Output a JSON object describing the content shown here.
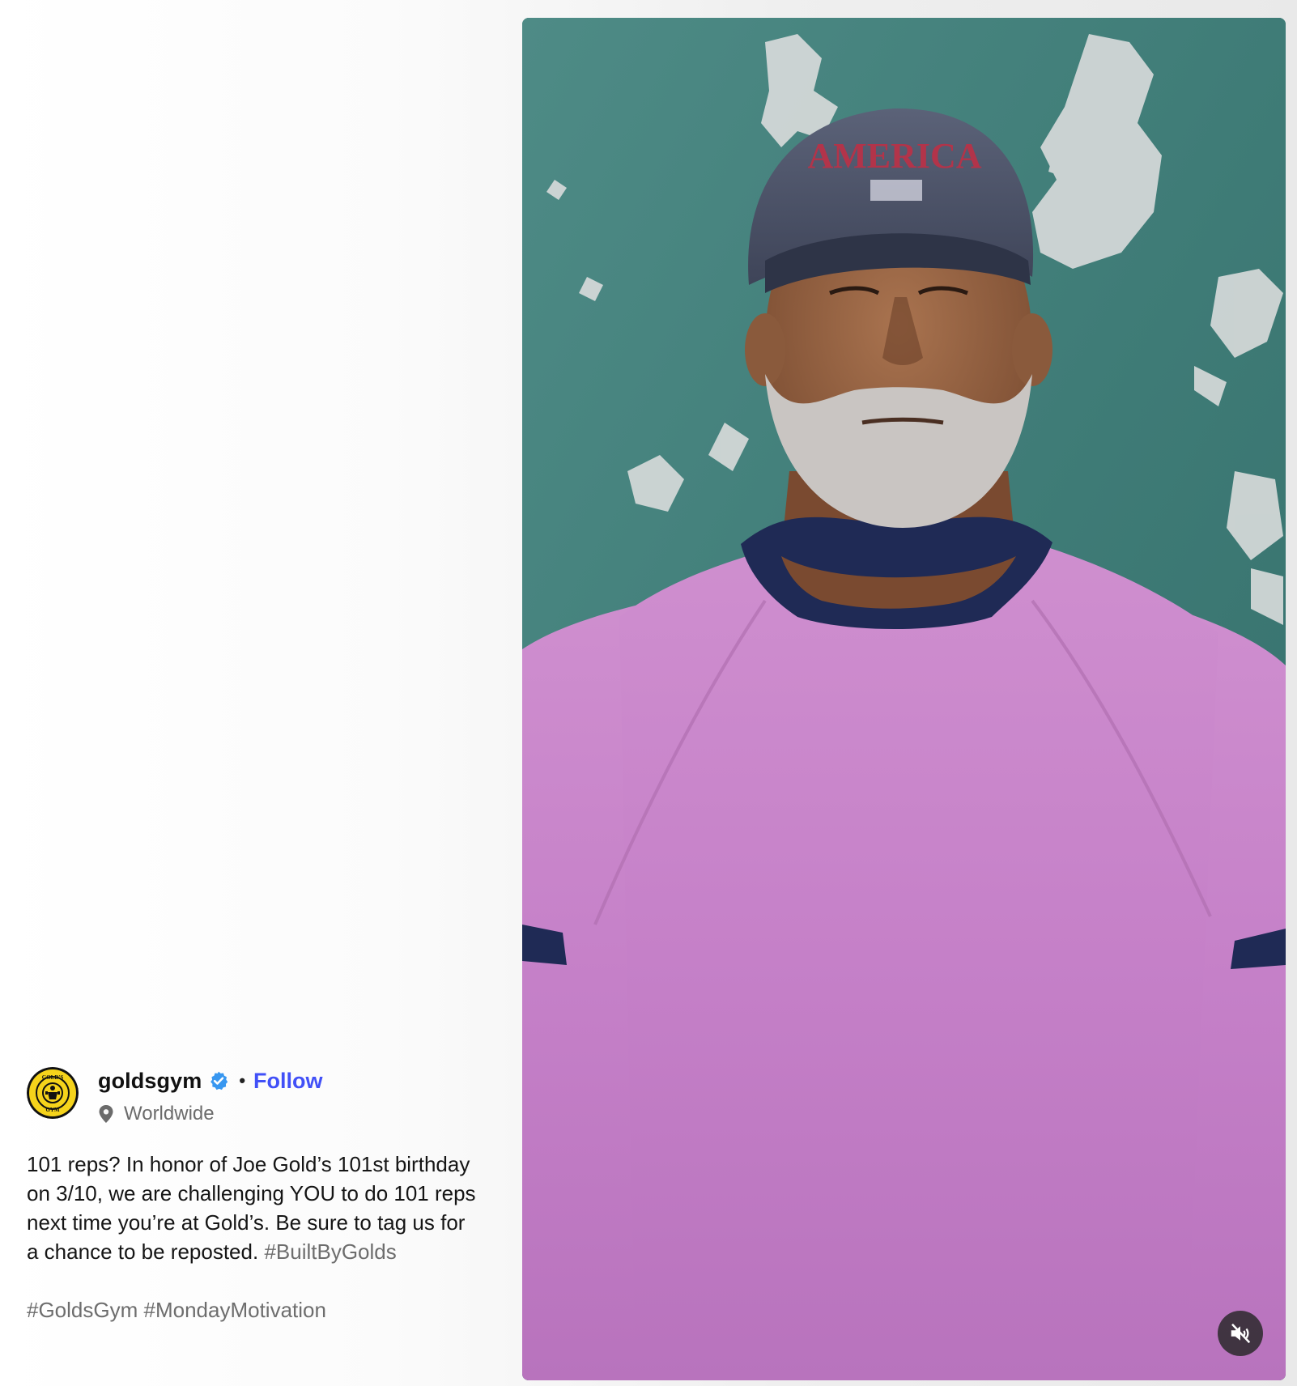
{
  "post": {
    "username": "goldsgym",
    "separator": "•",
    "follow_label": "Follow",
    "location": "Worldwide",
    "caption_text": "101 reps? In honor of Joe Gold’s 101st birthday on 3/10, we are challenging YOU to do 101 reps next time you’re at Gold’s. Be sure to tag us for a chance to be reposted.",
    "caption_hashtag": "#BuiltByGolds",
    "hashtags_line": [
      "#GoldsGym",
      "#MondayMotivation"
    ]
  },
  "media": {
    "type": "video",
    "cap_text": "AMERICA",
    "mute_icon": "speaker-muted-icon"
  },
  "avatar": {
    "logo_top_text": "GOLD'S",
    "logo_bottom_text": "GYM"
  },
  "colors": {
    "follow": "#4150f7",
    "hashtag": "#6d6d6d",
    "verified": "#3897f0",
    "logo_yellow": "#f5d31b"
  }
}
